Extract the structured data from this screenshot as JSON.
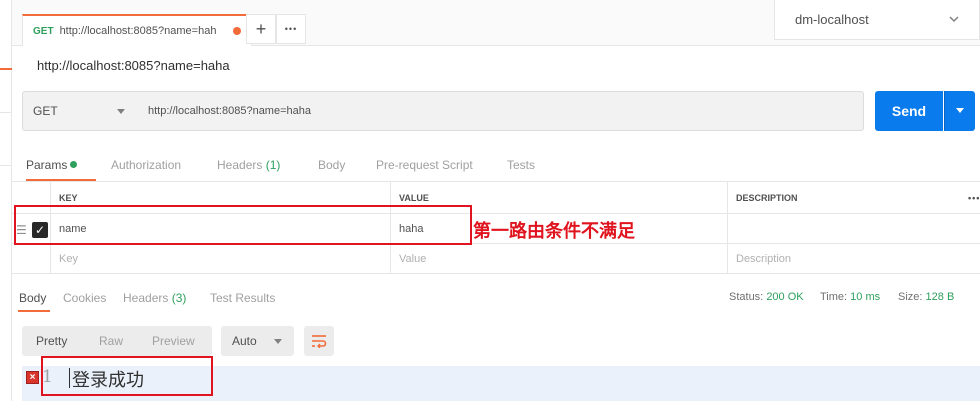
{
  "tab": {
    "method": "GET",
    "url": "http://localhost:8085?name=hah"
  },
  "tab_buttons": {
    "new_tab": "+",
    "more": "•••"
  },
  "environment": {
    "selected": "dm-localhost"
  },
  "request_title": "http://localhost:8085?name=haha",
  "url_bar": {
    "method": "GET",
    "url": "http://localhost:8085?name=haha",
    "send_label": "Send"
  },
  "request_tabs": {
    "params": "Params",
    "authorization": "Authorization",
    "headers": "Headers",
    "headers_count": "(1)",
    "body": "Body",
    "prerequest": "Pre-request Script",
    "tests": "Tests"
  },
  "params_table": {
    "headers": {
      "key": "KEY",
      "value": "VALUE",
      "description": "DESCRIPTION",
      "more": "•••"
    },
    "rows": [
      {
        "key": "name",
        "value": "haha",
        "description": "",
        "checked": true
      }
    ],
    "placeholder": {
      "key": "Key",
      "value": "Value",
      "description": "Description"
    }
  },
  "annotation": "第一路由条件不满足",
  "response_tabs": {
    "body": "Body",
    "cookies": "Cookies",
    "headers": "Headers",
    "headers_count": "(3)",
    "test_results": "Test Results"
  },
  "response_status": {
    "status_label": "Status:",
    "status_value": "200 OK",
    "time_label": "Time:",
    "time_value": "10 ms",
    "size_label": "Size:",
    "size_value": "128 B"
  },
  "format": {
    "pretty": "Pretty",
    "raw": "Raw",
    "preview": "Preview",
    "auto": "Auto"
  },
  "editor": {
    "line_number": "1",
    "content": "登录成功"
  },
  "colors": {
    "accent": "#f26b3a",
    "send": "#097bed",
    "success": "#2f9f5d",
    "annotation": "#e0141e"
  }
}
